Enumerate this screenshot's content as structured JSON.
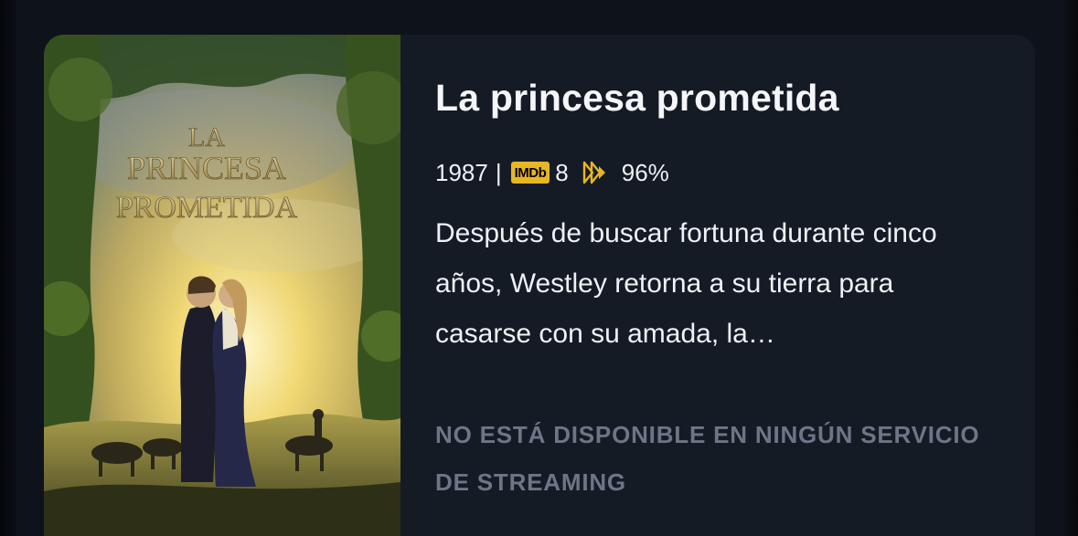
{
  "movie": {
    "title": "La princesa prometida",
    "year": "1987",
    "separator": "|",
    "imdb_badge": "IMDb",
    "imdb_score": "8",
    "rt_score": "96%",
    "description": "Después de buscar fortuna durante cinco años, Westley retorna a su tierra para casarse con su amada, la…",
    "availability": "NO ESTÁ DISPONIBLE EN NINGÚN SERVICIO DE STREAMING",
    "poster": {
      "title_line1": "LA",
      "title_line2": "PRINCESA",
      "title_line3": "PROMETIDA"
    }
  },
  "icons": {
    "imdb": "imdb-logo-icon",
    "rt": "rotten-tomatoes-play-icon"
  },
  "colors": {
    "background": "#0d111a",
    "card": "#151b25",
    "imdb_yellow": "#e7b623",
    "muted_text": "#6c7686"
  }
}
